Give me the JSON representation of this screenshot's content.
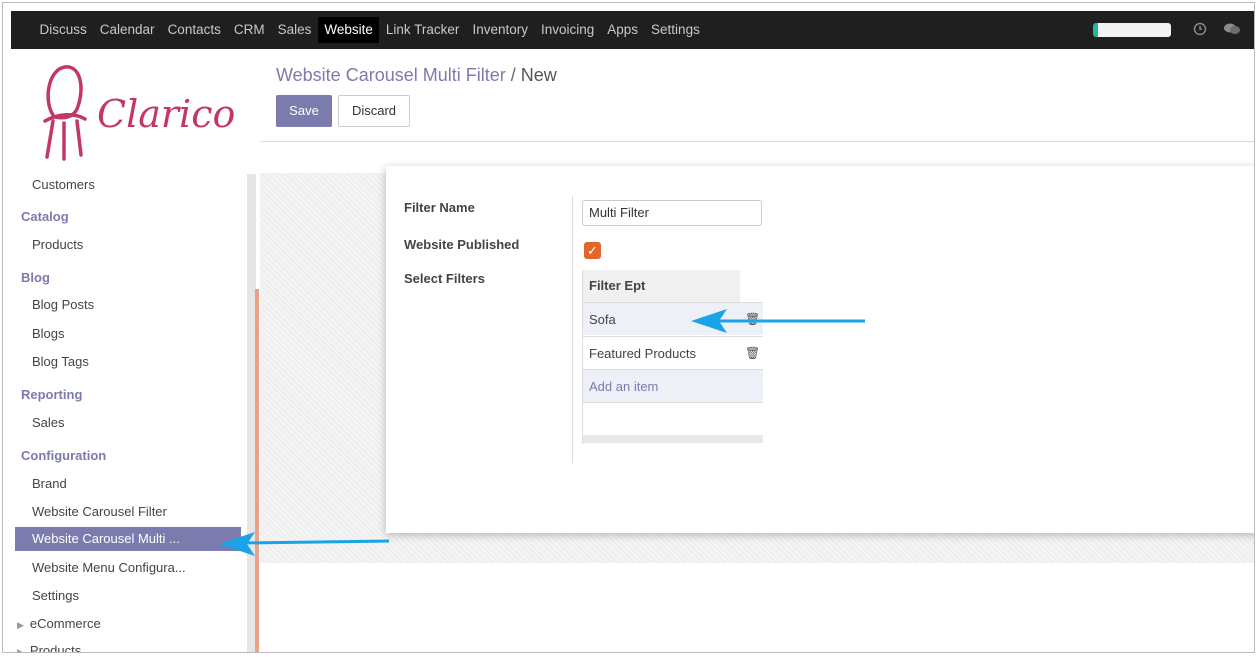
{
  "topbar": {
    "menu": [
      "Discuss",
      "Calendar",
      "Contacts",
      "CRM",
      "Sales",
      "Website",
      "Link Tracker",
      "Inventory",
      "Invoicing",
      "Apps",
      "Settings"
    ],
    "active": "Website",
    "icons": [
      "clock-icon",
      "chat-icon"
    ]
  },
  "logo": {
    "text": "Clarico"
  },
  "sidebar": {
    "items": [
      {
        "type": "item",
        "label": "Customers"
      },
      {
        "type": "section",
        "label": "Catalog"
      },
      {
        "type": "item",
        "label": "Products"
      },
      {
        "type": "section",
        "label": "Blog"
      },
      {
        "type": "item",
        "label": "Blog Posts"
      },
      {
        "type": "item",
        "label": "Blogs"
      },
      {
        "type": "item",
        "label": "Blog Tags"
      },
      {
        "type": "section",
        "label": "Reporting"
      },
      {
        "type": "item",
        "label": "Sales"
      },
      {
        "type": "section",
        "label": "Configuration"
      },
      {
        "type": "item",
        "label": "Brand"
      },
      {
        "type": "item",
        "label": "Website Carousel Filter"
      },
      {
        "type": "item",
        "label": "Website Carousel Multi ...",
        "active": true
      },
      {
        "type": "item",
        "label": "Website Menu Configura..."
      },
      {
        "type": "item",
        "label": "Settings"
      },
      {
        "type": "group",
        "label": "eCommerce"
      },
      {
        "type": "group",
        "label": "Products"
      }
    ]
  },
  "breadcrumb": {
    "parent": "Website Carousel Multi Filter",
    "separator": "/",
    "current": "New"
  },
  "buttons": {
    "save": "Save",
    "discard": "Discard"
  },
  "form": {
    "filter_name_label": "Filter Name",
    "filter_name_value": "Multi Filter",
    "published_label": "Website Published",
    "published": true,
    "select_filters_label": "Select Filters",
    "table_header": "Filter Ept",
    "rows": [
      "Sofa",
      "Featured Products"
    ],
    "add_item": "Add an item"
  },
  "colors": {
    "accent": "#7c7bad",
    "topbar": "#1f1f1f",
    "checkbox": "#e2672c",
    "annotation_arrow": "#1aa3e8"
  }
}
